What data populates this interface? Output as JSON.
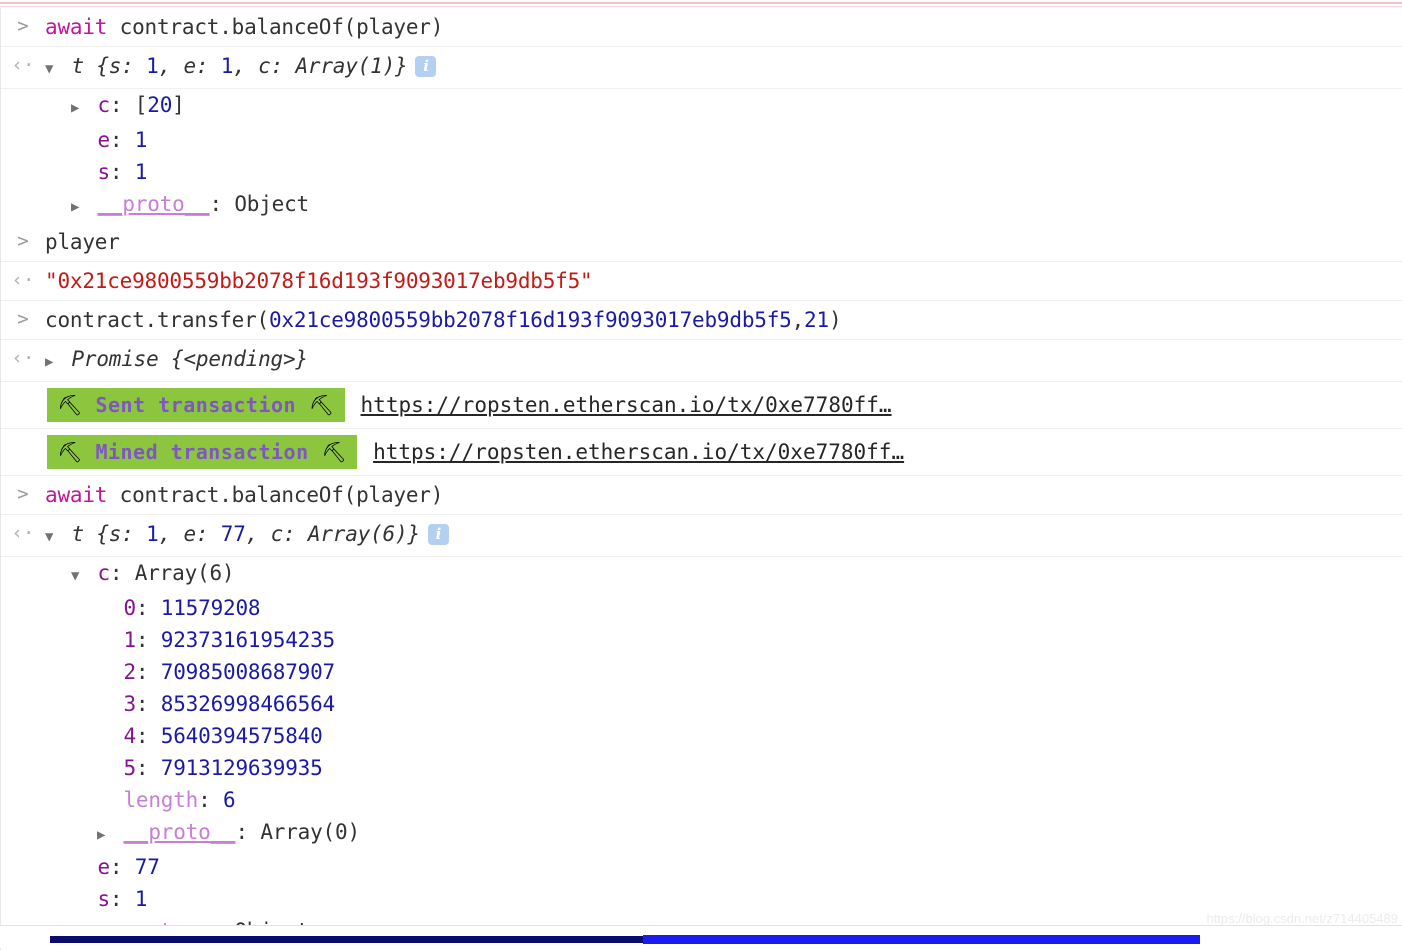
{
  "app": {
    "name": "chrome-devtools-console",
    "watermark": "https://blog.csdn.net/z714405489"
  },
  "colors": {
    "keyword": "#c2169c",
    "number": "#1a1aa6",
    "string": "#c41a16",
    "property": "#881391",
    "proto": "#c77fd6",
    "badge_background": "#8cc63e",
    "badge_text": "#7e57c2",
    "scrollbar_thumb": "#1b1bf0",
    "scrollbar_track": "#0b0b6b",
    "info_icon": "#b3d0f2"
  },
  "icons": {
    "input_prompt": ">",
    "output_prompt": "‹·",
    "triangle_open": "▼",
    "triangle_closed": "▶",
    "info": "i",
    "pickaxe": "⛏"
  },
  "console_rows": [
    {
      "kind": "input",
      "prompt": ">",
      "segments": [
        {
          "text": "await ",
          "style": "kw"
        },
        {
          "text": "contract.balanceOf(player)",
          "style": "plain"
        }
      ]
    },
    {
      "kind": "output",
      "prompt": "‹·",
      "expander": "▼",
      "segments": [
        {
          "text": "t {s: ",
          "style": "objname"
        },
        {
          "text": "1",
          "style": "num"
        },
        {
          "text": ", e: ",
          "style": "objname"
        },
        {
          "text": "1",
          "style": "num"
        },
        {
          "text": ", c: Array(1)}",
          "style": "objname"
        }
      ],
      "info_badge": "i"
    },
    {
      "kind": "tree",
      "indent": 1,
      "expander": "▶",
      "key": "c",
      "key_style": "prop",
      "value": "[20]",
      "value_style": "num-bracket"
    },
    {
      "kind": "tree",
      "indent": 1,
      "expander": "",
      "key": "e",
      "key_style": "prop",
      "value": "1",
      "value_style": "num"
    },
    {
      "kind": "tree",
      "indent": 1,
      "expander": "",
      "key": "s",
      "key_style": "prop",
      "value": "1",
      "value_style": "num"
    },
    {
      "kind": "tree",
      "indent": 1,
      "expander": "▶",
      "key": "__proto__",
      "key_style": "proto",
      "value": "Object",
      "value_style": "plain"
    },
    {
      "kind": "input",
      "prompt": ">",
      "segments": [
        {
          "text": "player",
          "style": "plain"
        }
      ]
    },
    {
      "kind": "output",
      "prompt": "‹·",
      "segments": [
        {
          "text": "\"0x21ce9800559bb2078f16d193f9093017eb9db5f5\"",
          "style": "str"
        }
      ]
    },
    {
      "kind": "input",
      "prompt": ">",
      "segments": [
        {
          "text": "contract.transfer(",
          "style": "plain"
        },
        {
          "text": "0x21ce9800559bb2078f16d193f9093017eb9db5f5",
          "style": "num"
        },
        {
          "text": ",",
          "style": "plain"
        },
        {
          "text": "21",
          "style": "num"
        },
        {
          "text": ")",
          "style": "plain"
        }
      ]
    },
    {
      "kind": "output",
      "prompt": "‹·",
      "expander": "▶",
      "segments": [
        {
          "text": "Promise {<pending>}",
          "style": "objname"
        }
      ]
    },
    {
      "kind": "transaction",
      "badge_label": "Sent transaction",
      "url": "https://ropsten.etherscan.io/tx/0xe7780ff…"
    },
    {
      "kind": "transaction",
      "badge_label": "Mined transaction",
      "url": "https://ropsten.etherscan.io/tx/0xe7780ff…"
    },
    {
      "kind": "input",
      "prompt": ">",
      "segments": [
        {
          "text": "await ",
          "style": "kw"
        },
        {
          "text": "contract.balanceOf(player)",
          "style": "plain"
        }
      ]
    },
    {
      "kind": "output",
      "prompt": "‹·",
      "expander": "▼",
      "segments": [
        {
          "text": "t {s: ",
          "style": "objname"
        },
        {
          "text": "1",
          "style": "num"
        },
        {
          "text": ", e: ",
          "style": "objname"
        },
        {
          "text": "77",
          "style": "num"
        },
        {
          "text": ", c: Array(6)}",
          "style": "objname"
        }
      ],
      "info_badge": "i"
    },
    {
      "kind": "tree",
      "indent": 1,
      "expander": "▼",
      "key": "c",
      "key_style": "prop",
      "value": "Array(6)",
      "value_style": "plain"
    },
    {
      "kind": "tree",
      "indent": 2,
      "expander": "",
      "key": "0",
      "key_style": "prop",
      "value": "11579208",
      "value_style": "num"
    },
    {
      "kind": "tree",
      "indent": 2,
      "expander": "",
      "key": "1",
      "key_style": "prop",
      "value": "92373161954235",
      "value_style": "num"
    },
    {
      "kind": "tree",
      "indent": 2,
      "expander": "",
      "key": "2",
      "key_style": "prop",
      "value": "70985008687907",
      "value_style": "num"
    },
    {
      "kind": "tree",
      "indent": 2,
      "expander": "",
      "key": "3",
      "key_style": "prop",
      "value": "85326998466564",
      "value_style": "num"
    },
    {
      "kind": "tree",
      "indent": 2,
      "expander": "",
      "key": "4",
      "key_style": "prop",
      "value": "5640394575840",
      "value_style": "num"
    },
    {
      "kind": "tree",
      "indent": 2,
      "expander": "",
      "key": "5",
      "key_style": "prop",
      "value": "7913129639935",
      "value_style": "num"
    },
    {
      "kind": "tree",
      "indent": 2,
      "expander": "",
      "key": "length",
      "key_style": "length",
      "value": "6",
      "value_style": "num"
    },
    {
      "kind": "tree",
      "indent": 2,
      "expander": "▶",
      "key": "__proto__",
      "key_style": "proto",
      "value": "Array(0)",
      "value_style": "plain"
    },
    {
      "kind": "tree",
      "indent": 1,
      "expander": "",
      "key": "e",
      "key_style": "prop",
      "value": "77",
      "value_style": "num"
    },
    {
      "kind": "tree",
      "indent": 1,
      "expander": "",
      "key": "s",
      "key_style": "prop",
      "value": "1",
      "value_style": "num"
    },
    {
      "kind": "tree",
      "indent": 1,
      "expander": "▶",
      "key": "__proto__",
      "key_style": "proto",
      "value": "Object",
      "value_style": "plain"
    }
  ]
}
